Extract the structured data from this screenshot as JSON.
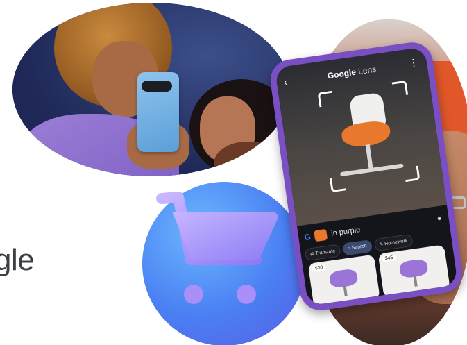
{
  "side_text": "gle",
  "phone": {
    "app_title_main": "Google",
    "app_title_rest": " Lens",
    "back_glyph": "‹",
    "more_glyph": "⋮",
    "search_query": "in purple",
    "chips": [
      {
        "label": "Translate",
        "icon": "translate-icon"
      },
      {
        "label": "Search",
        "icon": "search-icon"
      },
      {
        "label": "Homework",
        "icon": "homework-icon"
      }
    ],
    "results": [
      {
        "price": "$30"
      },
      {
        "price": "$45"
      }
    ]
  },
  "colors": {
    "phone_case": "#7a4fc3",
    "cart_circle": "#4a7ff2",
    "chair_orange": "#e8782c",
    "chair_purple": "#9b74d8"
  }
}
